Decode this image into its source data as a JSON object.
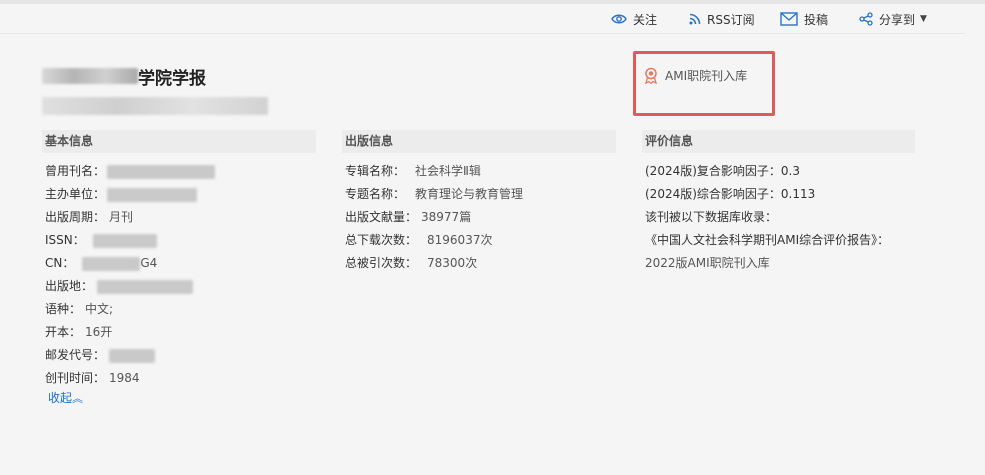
{
  "toolbar": {
    "follow_label": "关注",
    "rss_label": "RSS订阅",
    "submit_label": "投稿",
    "share_label": "分享到"
  },
  "journal": {
    "title_suffix": "学院学报"
  },
  "ami_badge": {
    "label": "AMI职院刊入库",
    "accent": "#e15a5a"
  },
  "basic": {
    "heading": "基本信息",
    "former_name_label": "曾用刊名：",
    "sponsor_label": "主办单位：",
    "period_label": "出版周期：",
    "period_value": "月刊",
    "issn_label": "ISSN：",
    "cn_label": "CN：",
    "cn_value_tail": "G4",
    "place_label": "出版地：",
    "lang_label": "语种：",
    "lang_value": "中文;",
    "format_label": "开本：",
    "format_value": "16开",
    "postal_label": "邮发代号：",
    "founded_label": "创刊时间：",
    "founded_value": "1984",
    "collapse_label": "收起"
  },
  "publish": {
    "heading": "出版信息",
    "series_label": "专辑名称：",
    "series_value": "社会科学Ⅱ辑",
    "topic_label": "专题名称：",
    "topic_value": "教育理论与教育管理",
    "docs_label": "出版文献量：",
    "docs_value": "38977篇",
    "downloads_label": "总下载次数：",
    "downloads_value": "8196037次",
    "cites_label": "总被引次数：",
    "cites_value": "78300次"
  },
  "evaluation": {
    "heading": "评价信息",
    "impact_composite": "(2024版)复合影响因子：0.3",
    "impact_overall": "(2024版)综合影响因子：0.113",
    "included_label": "该刊被以下数据库收录：",
    "report_name": "《中国人文社会科学期刊AMI综合评价报告》：",
    "report_value": "2022版AMI职院刊入库"
  },
  "colors": {
    "link": "#1a6fc9",
    "icon_blue": "#2a73c8"
  }
}
